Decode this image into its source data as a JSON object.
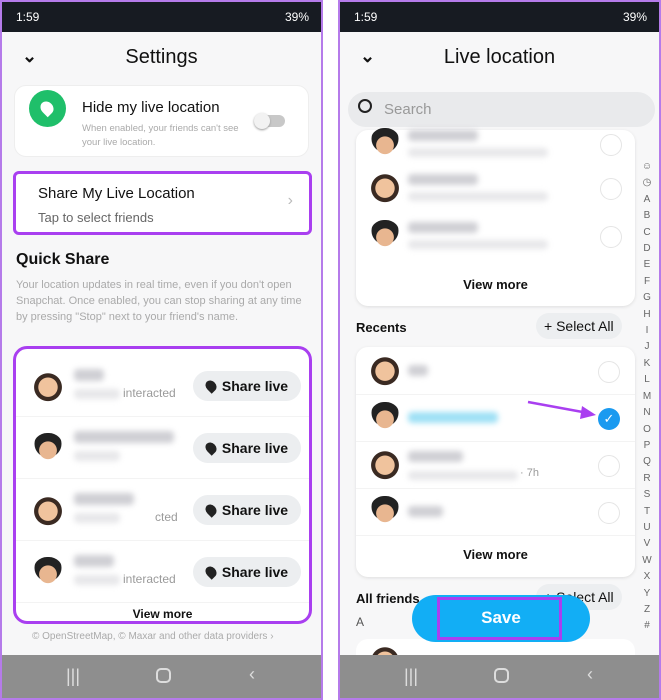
{
  "status_bar": {
    "time": "1:59",
    "battery": "39%"
  },
  "left": {
    "title": "Settings",
    "hide_card": {
      "title": "Hide my live location",
      "subtitle": "When enabled, your friends can't see your live location.",
      "toggle_on": false
    },
    "share_card": {
      "title": "Share My Live Location",
      "subtitle": "Tap to select friends"
    },
    "quick_share": {
      "heading": "Quick Share",
      "description": "Your location updates in real time, even if you don't open Snapchat. Once enabled, you can stop sharing at any time by pressing \"Stop\" next to your friend's name.",
      "rows": [
        {
          "status": "interacted",
          "button": "Share live"
        },
        {
          "status": "",
          "button": "Share live"
        },
        {
          "status": "cted",
          "button": "Share live"
        },
        {
          "status": "interacted",
          "button": "Share live"
        }
      ],
      "view_more": "View more"
    },
    "footer": "© OpenStreetMap, © Maxar and other data providers"
  },
  "right": {
    "title": "Live location",
    "search_placeholder": "Search",
    "top_view_more": "View more",
    "recents": {
      "heading": "Recents",
      "select_all": "+ Select All",
      "rows": [
        {
          "meta": "",
          "checked": false
        },
        {
          "meta": "",
          "checked": true
        },
        {
          "meta": "· 7h",
          "checked": false
        },
        {
          "meta": "",
          "checked": false
        }
      ],
      "view_more": "View more"
    },
    "all_friends": {
      "heading": "All friends",
      "select_all": "+ Select All",
      "section": "A"
    },
    "save": "Save",
    "index": [
      "☺",
      "◷",
      "A",
      "B",
      "C",
      "D",
      "E",
      "F",
      "G",
      "H",
      "I",
      "J",
      "K",
      "L",
      "M",
      "N",
      "O",
      "P",
      "Q",
      "R",
      "S",
      "T",
      "U",
      "V",
      "W",
      "X",
      "Y",
      "Z",
      "#"
    ]
  },
  "colors": {
    "highlight": "#a93ff0",
    "save_blue": "#12aef5",
    "check_blue": "#1a9af0",
    "green": "#1fbf6a"
  }
}
